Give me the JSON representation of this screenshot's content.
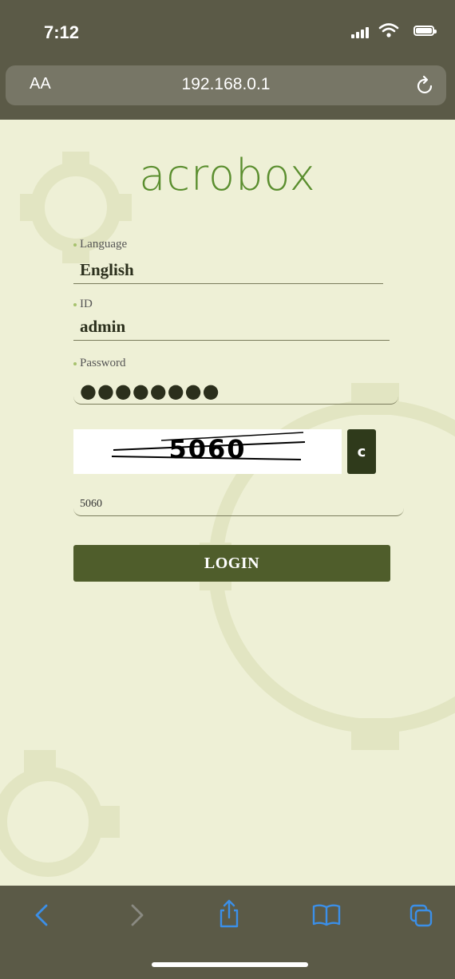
{
  "status_bar": {
    "time": "7:12"
  },
  "browser": {
    "aa_label": "AA",
    "url": "192.168.0.1"
  },
  "logo": {
    "text": "acrobox"
  },
  "form": {
    "language_label": "Language",
    "language_value": "English",
    "id_label": "ID",
    "id_value": "admin",
    "password_label": "Password",
    "password_mask": "●●●●●●●●",
    "captcha_image_text": "5060",
    "captcha_refresh_label": "c",
    "captcha_input_value": "5060",
    "login_label": "LOGIN"
  },
  "toolbar": {
    "icons": [
      "back-icon",
      "forward-icon",
      "share-icon",
      "bookmarks-icon",
      "tabs-icon"
    ]
  },
  "colors": {
    "chrome": "#5b5a47",
    "page_bg": "#eef0d6",
    "logo": "#5a8e2e",
    "login_button": "#4f5d2b",
    "toolbar_active": "#3b8fe8",
    "toolbar_disabled": "#8a8a82"
  }
}
